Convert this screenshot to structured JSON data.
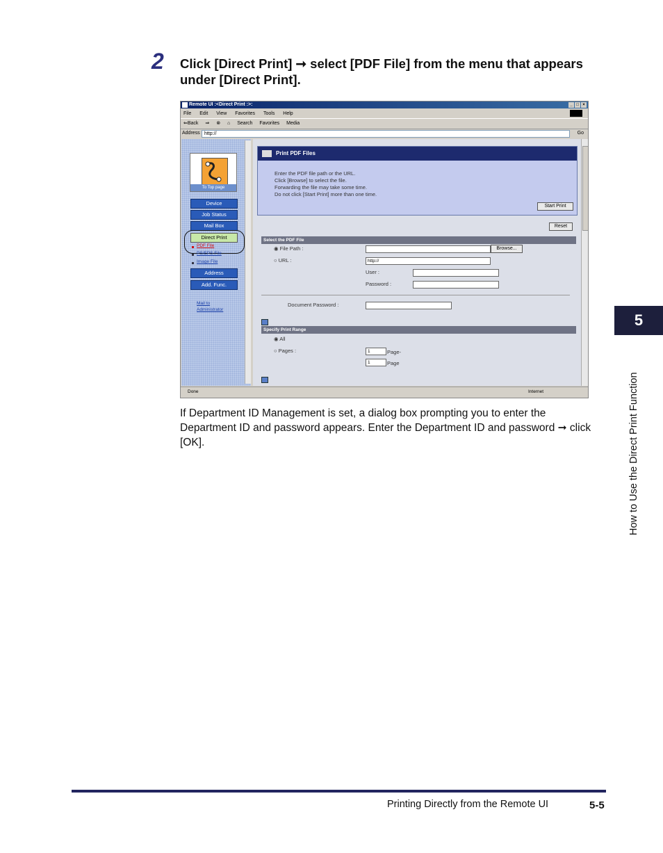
{
  "step": {
    "number": "2",
    "instruction": "Click [Direct Print] ➞ select [PDF File] from the menu that appears under [Direct Print]."
  },
  "screenshot": {
    "window_title": "Remote UI :<Direct Print :>:",
    "menu": [
      "File",
      "Edit",
      "View",
      "Favorites",
      "Tools",
      "Help"
    ],
    "toolbar": [
      "⇐Back",
      "⇒",
      "⊗",
      "⌂",
      "Search",
      "Favorites",
      "Media"
    ],
    "address_label": "Address",
    "address_value": "http://",
    "go_label": "Go",
    "sidebar": {
      "logo_caption": "To Top page",
      "buttons": [
        "Device",
        "Job Status",
        "Mail Box",
        "Direct Print"
      ],
      "sub_links": [
        "PDF File",
        "PS/EPS File",
        "Image File"
      ],
      "buttons2": [
        "Address",
        "Add. Func."
      ],
      "mail_link_1": "Mail to",
      "mail_link_2": "Administrator"
    },
    "panel": {
      "title": "Print PDF Files",
      "lines": [
        "Enter the PDF file path or the URL.",
        "Click [Browse] to select the file.",
        "Forwarding the file may take some time.",
        "Do not click [Start Print] more than one time."
      ],
      "start_button": "Start Print"
    },
    "reset_button": "Reset",
    "section1": "Select the PDF File",
    "file_path_label": "File Path :",
    "browse_button": "Browse...",
    "url_label": "URL :",
    "url_value": "http://",
    "user_label": "User :",
    "password_label": "Password :",
    "doc_password_label": "Document Password :",
    "section2": "Specify Print Range",
    "all_label": "All",
    "pages_label": "Pages :",
    "page_from": "1",
    "page_from_suffix": "Page-",
    "page_to": "1",
    "page_to_suffix": "Page",
    "status_done": "Done",
    "status_zone": "Internet"
  },
  "body_text": "If Department ID Management is set, a dialog box prompting you to enter the Department ID and password appears. Enter the Department ID and password ➞ click [OK].",
  "chapter_number": "5",
  "side_title": "How to Use the Direct Print Function",
  "footer": {
    "title": "Printing Directly from the Remote UI",
    "page": "5-5"
  }
}
